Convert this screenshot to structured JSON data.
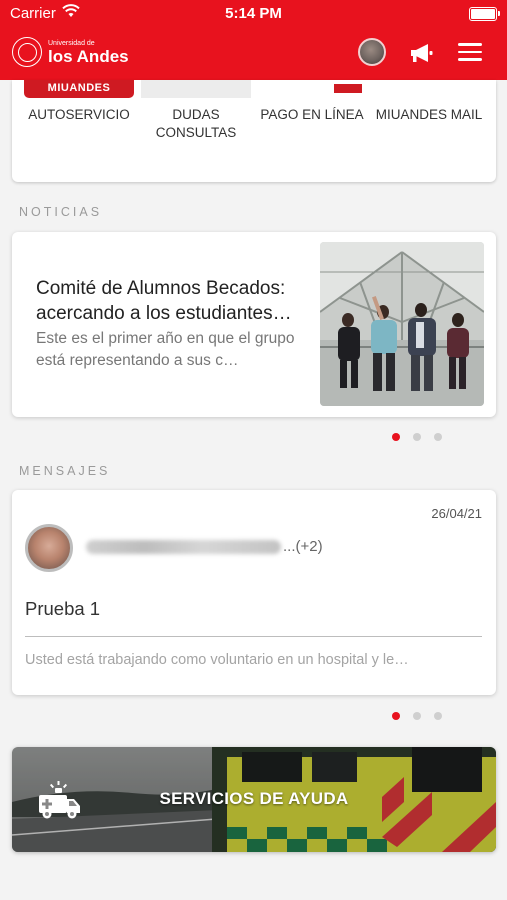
{
  "status_bar": {
    "carrier": "Carrier",
    "time": "5:14 PM"
  },
  "header": {
    "logo_small": "Universidad de",
    "logo_big": "los Andes",
    "icons": [
      "avatar",
      "megaphone-icon",
      "menu-icon"
    ]
  },
  "quick_access": {
    "items": [
      {
        "label": "AUTOSERVICIO",
        "thumb_text": "MIUANDES"
      },
      {
        "label": "DUDAS\nCONSULTAS"
      },
      {
        "label": "PAGO EN LÍNEA"
      },
      {
        "label": "MIUANDES MAIL"
      }
    ]
  },
  "news": {
    "section_title": "NOTICIAS",
    "title": "Comité de Alumnos Becados: acercando a los estudiantes…",
    "description": "Este es el primer año en que el grupo está representando a sus c…",
    "pagination": {
      "count": 3,
      "active": 0
    }
  },
  "messages": {
    "section_title": "MENSAJES",
    "date": "26/04/21",
    "sender_suffix": "...(+2)",
    "subject": "Prueba 1",
    "preview": "Usted está trabajando como voluntario en un hospital y le…",
    "pagination": {
      "count": 3,
      "active": 0
    }
  },
  "help": {
    "label": "SERVICIOS DE AYUDA"
  },
  "colors": {
    "brand_red": "#e8121e",
    "background": "#f3f3f3"
  }
}
